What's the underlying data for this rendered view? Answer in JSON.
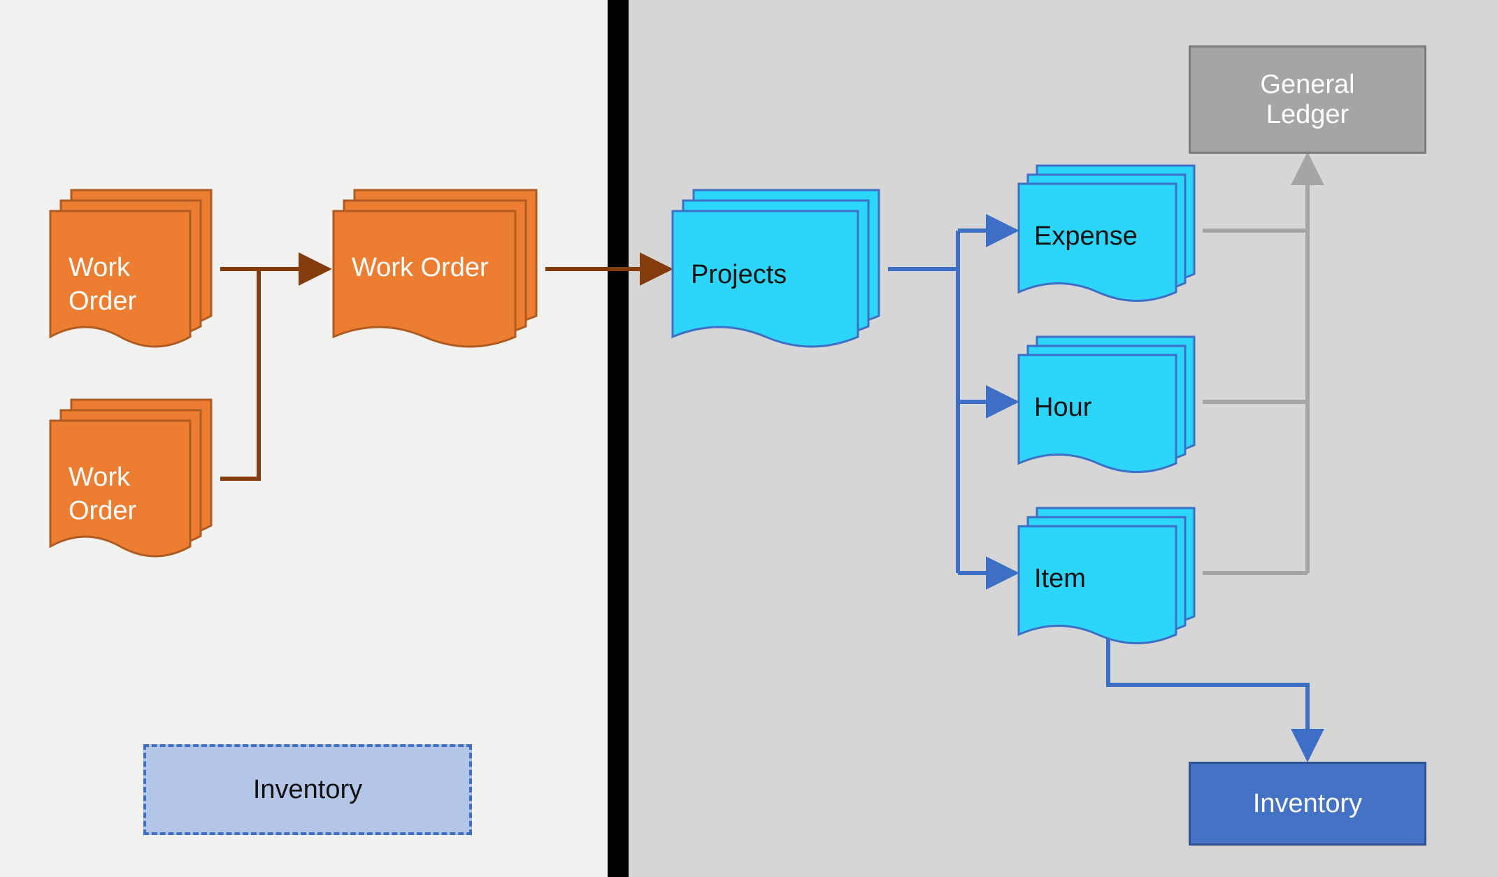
{
  "panels": {
    "left_bg": "#f1f1f0",
    "right_bg": "#d6d6d6",
    "divider_color": "#000000"
  },
  "colors": {
    "orange_fill": "#ed7d31",
    "orange_stroke": "#ae5a21",
    "cyan_fill": "#2bd6fa",
    "cyan_stroke": "#3d6fc6",
    "gray_fill": "#a5a5a5",
    "gray_stroke": "#7b7b7b",
    "blue_fill": "#4472c4",
    "blue_stroke": "#2f528f",
    "lav_fill": "#b4c6e7",
    "arrow_orange": "#843c0c",
    "arrow_blue": "#3d6fc6",
    "arrow_gray": "#a5a5a5"
  },
  "nodes": {
    "wo1": "Work\nOrder",
    "wo2": "Work\nOrder",
    "wo_main": "Work Order",
    "projects": "Projects",
    "expense": "Expense",
    "hour": "Hour",
    "item": "Item",
    "gl": "General\nLedger",
    "inv_left": "Inventory",
    "inv_right": "Inventory"
  }
}
